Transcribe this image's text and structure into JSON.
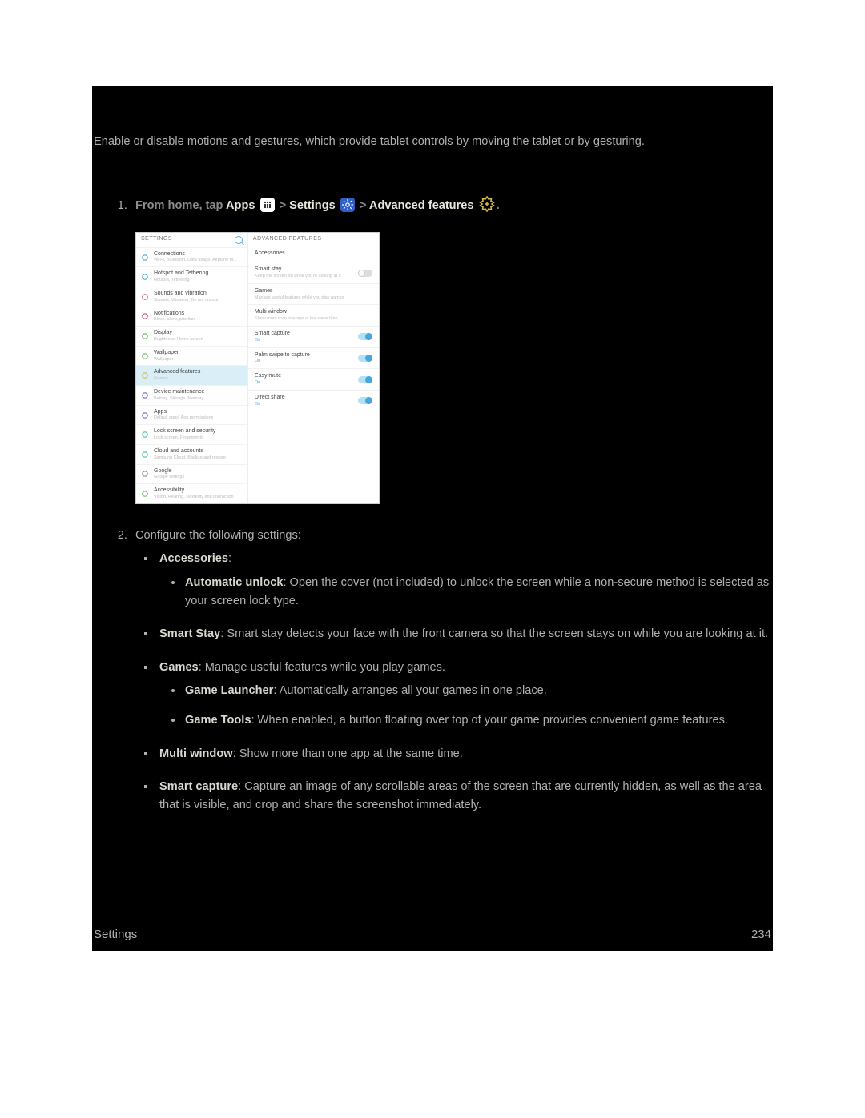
{
  "intro": "Enable or disable motions and gestures, which provide tablet controls by moving the tablet or by gesturing.",
  "step1": {
    "prefix": "From home, tap ",
    "apps": "Apps",
    "sep": " > ",
    "settings": "Settings",
    "adv": "Advanced features"
  },
  "shot": {
    "left_header": "SETTINGS",
    "right_header": "ADVANCED FEATURES",
    "left_items": [
      {
        "title": "Connections",
        "sub": "Wi-Fi, Bluetooth, Data usage, Airplane m...",
        "color": "#4aa8d8"
      },
      {
        "title": "Hotspot and Tethering",
        "sub": "Hotspot, Tethering",
        "color": "#4aa8d8"
      },
      {
        "title": "Sounds and vibration",
        "sub": "Sounds, Vibration, Do not disturb",
        "color": "#cc4f8a"
      },
      {
        "title": "Notifications",
        "sub": "Block, allow, prioritize",
        "color": "#cc4f8a"
      },
      {
        "title": "Display",
        "sub": "Brightness, Home screen",
        "color": "#6fb56a"
      },
      {
        "title": "Wallpaper",
        "sub": "Wallpaper",
        "color": "#6fb56a"
      },
      {
        "title": "Advanced features",
        "sub": "Games",
        "color": "#d8b84a",
        "selected": true
      },
      {
        "title": "Device maintenance",
        "sub": "Battery, Storage, Memory",
        "color": "#6a6fd8"
      },
      {
        "title": "Apps",
        "sub": "Default apps, App permissions",
        "color": "#6a6fd8"
      },
      {
        "title": "Lock screen and security",
        "sub": "Lock screen, Fingerprints",
        "color": "#55b8aa"
      },
      {
        "title": "Cloud and accounts",
        "sub": "Samsung Cloud, Backup and restore",
        "color": "#55b8aa"
      },
      {
        "title": "Google",
        "sub": "Google settings",
        "color": "#888"
      },
      {
        "title": "Accessibility",
        "sub": "Vision, Hearing, Dexterity and interaction",
        "color": "#6fb56a"
      }
    ],
    "right_items": [
      {
        "title": "Accessories",
        "sub": ""
      },
      {
        "title": "Smart stay",
        "sub": "Keep the screen on while you're looking at it",
        "toggle": "off"
      },
      {
        "title": "Games",
        "sub": "Manage useful features while you play games"
      },
      {
        "title": "Multi window",
        "sub": "Show more than one app at the same time"
      },
      {
        "title": "Smart capture",
        "sub": "On",
        "on": true,
        "toggle": "on"
      },
      {
        "title": "Palm swipe to capture",
        "sub": "On",
        "on": true,
        "toggle": "on"
      },
      {
        "title": "Easy mute",
        "sub": "On",
        "on": true,
        "toggle": "on"
      },
      {
        "title": "Direct share",
        "sub": "On",
        "on": true,
        "toggle": "on"
      }
    ]
  },
  "step2_lead": "Configure the following settings:",
  "bullets": {
    "accessories_label": "Accessories",
    "auto_unlock_label": "Automatic unlock",
    "auto_unlock_text": ": Open the cover (not included) to unlock the screen while a non-secure method is selected as your screen lock type.",
    "smart_stay_label": "Smart Stay",
    "smart_stay_text": ": Smart stay detects your face with the front camera so that the screen stays on while you are looking at it.",
    "games_label": "Games",
    "games_text": ": Manage useful features while you play games.",
    "game_launcher_label": "Game Launcher",
    "game_launcher_text": ": Automatically arranges all your games in one place.",
    "game_tools_label": "Game Tools",
    "game_tools_text": ": When enabled, a button floating over top of your game provides convenient game features.",
    "multi_window_label": "Multi window",
    "multi_window_text": ": Show more than one app at the same time.",
    "smart_capture_label": "Smart capture",
    "smart_capture_text": ": Capture an image of any scrollable areas of the screen that are currently hidden, as well as the area that is visible, and crop and share the screenshot immediately."
  },
  "footer": {
    "left": "Settings",
    "right": "234"
  }
}
